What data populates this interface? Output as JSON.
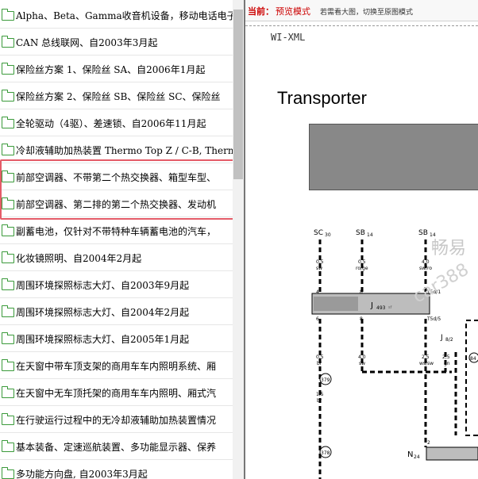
{
  "tree": {
    "items": [
      {
        "label": "Alpha、Beta、Gamma收音机设备，移动电话电子"
      },
      {
        "label": "CAN 总线联网、自2003年3月起"
      },
      {
        "label": "保险丝方案 1、保险丝 SA、自2006年1月起"
      },
      {
        "label": "保险丝方案 2、保险丝 SB、保险丝 SC、保险丝"
      },
      {
        "label": "全轮驱动（4驱）、差速锁、自2006年11月起"
      },
      {
        "label": "冷却液辅助加热装置 Thermo Top Z / C-B, Therm"
      },
      {
        "label": "前部空调器、不带第二个热交换器、箱型车型、"
      },
      {
        "label": "前部空调器、第二排的第二个热交换器、发动机"
      },
      {
        "label": "副蓄电池，仅针对不带特种车辆蓄电池的汽车，"
      },
      {
        "label": "化妆镜照明、自2004年2月起"
      },
      {
        "label": "周围环境探照标志大灯、自2003年9月起"
      },
      {
        "label": "周围环境探照标志大灯、自2004年2月起"
      },
      {
        "label": "周围环境探照标志大灯、自2005年1月起"
      },
      {
        "label": "在天窗中带车顶支架的商用车车内照明系统、厢"
      },
      {
        "label": "在天窗中无车顶托架的商用车车内照明、厢式汽"
      },
      {
        "label": "在行驶运行过程中的无冷却液辅助加热装置情况"
      },
      {
        "label": "基本装备、定速巡航装置、多功能显示器、保养"
      },
      {
        "label": "多功能方向盘, 自2003年3月起"
      }
    ]
  },
  "doc": {
    "current_label": "当前：",
    "current_mode": "预览模式",
    "mode_hint": "若需看大图，切换至原图模式",
    "code": "WI-XML",
    "title": "Transporter",
    "watermark_1": "畅易",
    "watermark_2": "car388",
    "diagram": {
      "terminals": [
        {
          "name": "SC",
          "sub": "30"
        },
        {
          "name": "SB",
          "sub": "14"
        },
        {
          "name": "SB",
          "sub": "14"
        }
      ],
      "relay": "J",
      "relay_sub": "493",
      "relay_tag": "sf",
      "relay_pin_top_1": "4",
      "relay_pin_top_2": "8",
      "relay_pin_bot_1": "6",
      "relay_pin_bot_2": "8",
      "j_right": "T5d/1",
      "j_right_2": "T5d/5",
      "j82": "J",
      "j82_sub": "8/2",
      "wire_05_a": "0,5",
      "wire_05_b": "0,5",
      "wire_05_c": "0,5",
      "wire_25_a": "2,5",
      "wire_25_b": "2,5",
      "wire_40_a": "4,0",
      "wire_40_b": "4,0",
      "wire_15": "1,5",
      "col_sw": "sw",
      "col_ro_ge": "ro/ge",
      "col_sw_ro": "sw/ro",
      "col_br": "br",
      "col_sw_ws": "ws/sw",
      "col_sw_2": "sw",
      "col_gn": "gn",
      "ref_379": "379",
      "ref_378": "378",
      "ref_84": "84",
      "n_label": "N",
      "n_sub": "24",
      "pin_2": "2"
    }
  }
}
